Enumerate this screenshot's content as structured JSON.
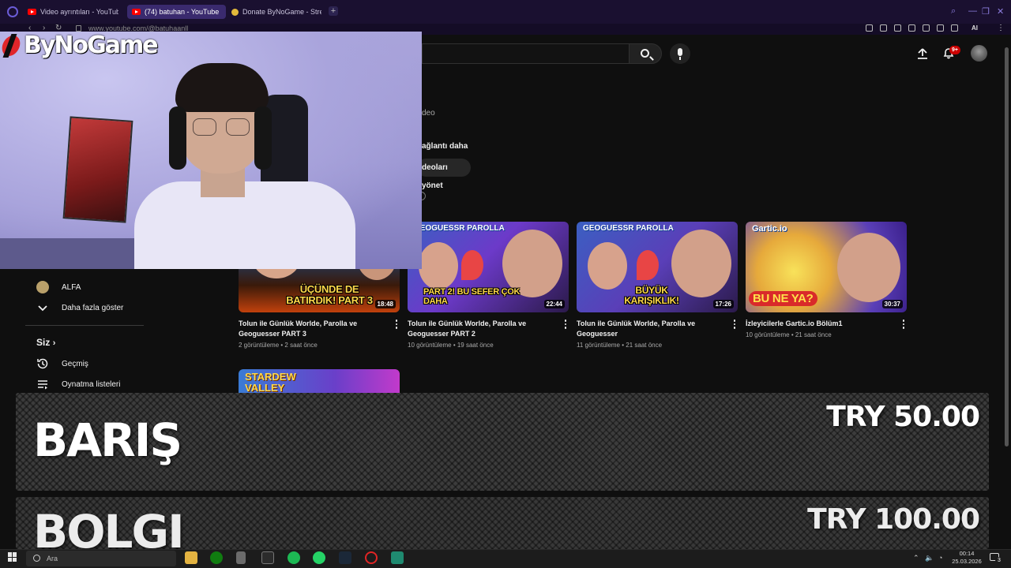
{
  "browser": {
    "tabs": [
      {
        "label": "Video ayrıntıları - YouTube",
        "active": false,
        "icon": "youtube-icon"
      },
      {
        "label": "(74) batuhan - YouTube",
        "active": true,
        "icon": "youtube-icon"
      },
      {
        "label": "Donate ByNoGame - Strea",
        "active": false,
        "icon": "bynogame-icon"
      }
    ],
    "url": "www.youtube.com/@batuhaanll"
  },
  "youtube": {
    "notification_count": "9+",
    "channel_fragment_video": "deo",
    "channel_link": "ağlantı daha",
    "manage_videos_label": "deoları yönet"
  },
  "sidebar": {
    "items_top": [
      {
        "label": "ALFA",
        "icon": "subscription-avatar-icon"
      },
      {
        "label": "Daha fazla göster",
        "icon": "chevron-down-icon"
      }
    ],
    "you_heading": "Siz",
    "items_you": [
      {
        "label": "Geçmiş",
        "icon": "history-icon"
      },
      {
        "label": "Oynatma listeleri",
        "icon": "playlists-icon"
      }
    ]
  },
  "videos": [
    {
      "title": "Tolun ile Günlük Worlde, Parolla ve Geoguesser PART 3",
      "views": "2 görüntüleme",
      "age": "2 saat önce",
      "duration": "18:48",
      "caption": "ÜÇÜNDE DE BATIRDIK! PART 3",
      "top_label": ""
    },
    {
      "title": "Tolun ile Günlük Worlde, Parolla ve Geoguesser PART 2",
      "views": "10 görüntüleme",
      "age": "19 saat önce",
      "duration": "22:44",
      "caption": "PART 2! BU SEFER ÇOK DAHA",
      "top_label": "GEOGUESSR PAROLLA"
    },
    {
      "title": "Tolun ile Günlük Worlde, Parolla ve Geoguesser",
      "views": "11 görüntüleme",
      "age": "21 saat önce",
      "duration": "17:26",
      "caption": "BÜYÜK KARIŞIKLIK!",
      "top_label": "GEOGUESSR PAROLLA"
    },
    {
      "title": "İzleyicilerle Gartic.io Bölüm1",
      "views": "10 görüntüleme",
      "age": "21 saat önce",
      "duration": "30:37",
      "caption": "BU NE YA?",
      "top_label": "Gartic.io"
    },
    {
      "title": "",
      "views": "",
      "age": "",
      "duration": "",
      "caption": "",
      "top_label": "STARDEW VALLEY"
    }
  ],
  "overlay": {
    "brand": "ByNoGame",
    "donations": [
      {
        "name": "BARIŞ",
        "amount": "TRY 50.00"
      },
      {
        "name": "BOLGI",
        "amount": "TRY 100.00"
      }
    ]
  },
  "taskbar": {
    "search_placeholder": "Ara",
    "time": "00:14",
    "date": "25.03.2026",
    "notification_count": "3"
  },
  "colors": {
    "yt_bg": "#0f0f0f",
    "yt_red": "#ff0000",
    "browser_accent": "#6b5cd6",
    "donation_bg": "#3c3c3c",
    "brand_red": "#e0262a"
  }
}
